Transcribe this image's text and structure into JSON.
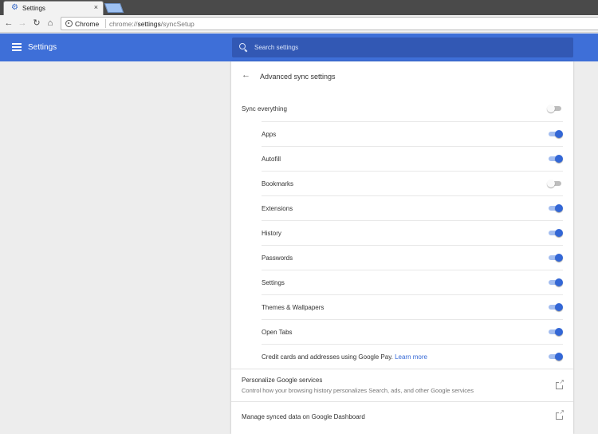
{
  "browser": {
    "tab_title": "Settings",
    "tab_close": "×",
    "omnibox_scheme_label": "Chrome",
    "url_prefix": "chrome://",
    "url_host": "settings",
    "url_path": "/syncSetup"
  },
  "header": {
    "title": "Settings",
    "search_placeholder": "Search settings"
  },
  "page": {
    "title": "Advanced sync settings"
  },
  "sync_everything": {
    "label": "Sync everything",
    "enabled": false
  },
  "sync_items": [
    {
      "label": "Apps",
      "enabled": true
    },
    {
      "label": "Autofill",
      "enabled": true
    },
    {
      "label": "Bookmarks",
      "enabled": false
    },
    {
      "label": "Extensions",
      "enabled": true
    },
    {
      "label": "History",
      "enabled": true
    },
    {
      "label": "Passwords",
      "enabled": true
    },
    {
      "label": "Settings",
      "enabled": true
    },
    {
      "label": "Themes & Wallpapers",
      "enabled": true
    },
    {
      "label": "Open Tabs",
      "enabled": true
    },
    {
      "label": "Credit cards and addresses using Google Pay.",
      "link": "Learn more",
      "enabled": true
    }
  ],
  "personalize": {
    "title": "Personalize Google services",
    "description": "Control how your browsing history personalizes Search, ads, and other Google services"
  },
  "dashboard": {
    "title": "Manage synced data on Google Dashboard"
  },
  "colors": {
    "header_bg": "#3e6fd8",
    "toggle_on": "#3367d6",
    "link": "#3367d6"
  }
}
